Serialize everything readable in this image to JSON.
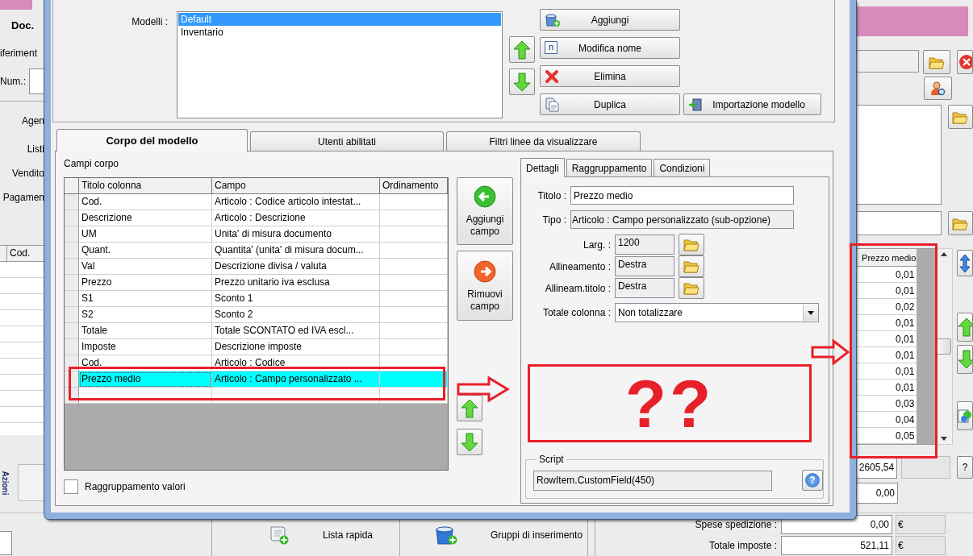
{
  "app": {
    "labels": {
      "doc": "Doc.",
      "riferimento": "iferiment",
      "num": "Num.:",
      "agente": "Agen",
      "listino": "Listi",
      "venditore": "Vendito",
      "pagamento": "Pagamen"
    },
    "grid_column": "Cod.",
    "side_tab": "Azioni",
    "price_grid": {
      "column": "Prezzo medio",
      "values": [
        "0,01",
        "0,01",
        "0,02",
        "0,01",
        "0,01",
        "0,01",
        "0,01",
        "0,01",
        "0,03",
        "0,04",
        "0,05"
      ]
    },
    "summary_values": [
      "2605,54",
      "0,00"
    ],
    "help_button": "?",
    "totals": [
      {
        "label": "Spese spedizione :",
        "value": "0,00",
        "currency": "€"
      },
      {
        "label": "Totale imposte :",
        "value": "521,11",
        "currency": "€"
      }
    ],
    "bottom_buttons": [
      {
        "label": "Lista rapida",
        "kind": "list"
      },
      {
        "label": "Gruppi di inserimento",
        "kind": "group"
      }
    ]
  },
  "dialog": {
    "models": {
      "label": "Modelli :",
      "items": [
        {
          "name": "Default",
          "selected": true
        },
        {
          "name": "Inventario",
          "selected": false
        }
      ]
    },
    "model_buttons": [
      {
        "label": "Aggiungi",
        "kind": "add"
      },
      {
        "label": "Modifica nome",
        "kind": "rename",
        "glyph": "n"
      },
      {
        "label": "Elimina",
        "kind": "delete"
      },
      {
        "label": "Duplica",
        "kind": "duplicate"
      }
    ],
    "import_button": "Importazione modello",
    "tabs": [
      {
        "label": "Corpo del modello",
        "selected": true
      },
      {
        "label": "Utenti abilitati",
        "selected": false
      },
      {
        "label": "Filtri linee da visualizzare",
        "selected": false
      }
    ],
    "fields_label": "Campi corpo",
    "grid": {
      "columns": [
        "Titolo colonna",
        "Campo",
        "Ordinamento"
      ],
      "rows": [
        {
          "title": "Cod.",
          "field": "Articolo : Codice articolo intestat...",
          "selected": false
        },
        {
          "title": "Descrizione",
          "field": "Articolo : Descrizione",
          "selected": false
        },
        {
          "title": "UM",
          "field": "Unita' di misura documento",
          "selected": false
        },
        {
          "title": "Quant.",
          "field": "Quantita' (unita' di misura docum...",
          "selected": false
        },
        {
          "title": "Val",
          "field": "Descrizione divisa / valuta",
          "selected": false
        },
        {
          "title": "Prezzo",
          "field": "Prezzo unitario iva esclusa",
          "selected": false
        },
        {
          "title": "S1",
          "field": "Sconto 1",
          "selected": false
        },
        {
          "title": "S2",
          "field": "Sconto 2",
          "selected": false
        },
        {
          "title": "Totale",
          "field": "Totale SCONTATO ed IVA escl...",
          "selected": false
        },
        {
          "title": "Imposte",
          "field": "Descrizione imposte",
          "selected": false
        },
        {
          "title": "Cod.",
          "field": "Articolo : Codice",
          "selected": false
        },
        {
          "title": "Prezzo medio",
          "field": "Articolo : Campo personalizzato ...",
          "selected": true
        }
      ]
    },
    "add_field_button": "Aggiungi campo",
    "remove_field_button": "Rimuovi campo",
    "grouping_checkbox": {
      "label": "Raggruppamento valori",
      "checked": false
    },
    "detail_tabs": [
      {
        "label": "Dettagli",
        "selected": true
      },
      {
        "label": "Raggruppamento",
        "selected": false
      },
      {
        "label": "Condizioni",
        "selected": false
      }
    ],
    "details": {
      "titolo_label": "Titolo :",
      "titolo": "Prezzo medio",
      "tipo_label": "Tipo :",
      "tipo": "Articolo : Campo personalizzato (sub-opzione)",
      "larg_label": "Larg. :",
      "larg": "1200",
      "allineamento_label": "Allineamento :",
      "allineamento": "Destra",
      "allineam_titolo_label": "Allineam.titolo :",
      "allineam_titolo": "Destra",
      "totale_label": "Totale colonna :",
      "totale": "Non totalizzare"
    },
    "script": {
      "legend": "Script",
      "value": "RowItem.CustomField(450)",
      "help": "?"
    }
  },
  "annotation": {
    "text": "??"
  }
}
